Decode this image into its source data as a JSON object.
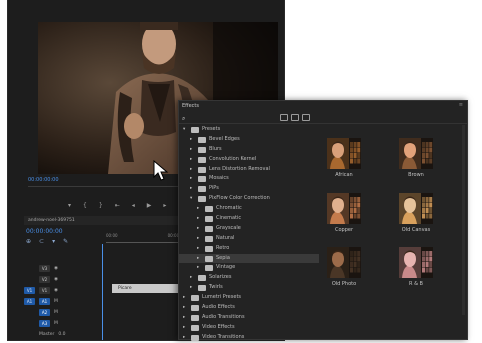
{
  "editor": {
    "program_timecode": "00:00:00:00",
    "sequence_name": "andrew-noel-369751",
    "timeline_timecode": "00:00:00:00",
    "ruler_ticks": [
      "00:00",
      "00:00:05:00"
    ],
    "transport_icons": [
      "marker-icon",
      "in-point-icon",
      "out-point-icon",
      "go-to-in-icon",
      "step-back-icon",
      "play-icon",
      "step-forward-icon",
      "go-to-out-icon"
    ],
    "tracks": [
      {
        "target": "",
        "name": "V3"
      },
      {
        "target": "",
        "name": "V2"
      },
      {
        "target": "V1",
        "name": "V1"
      },
      {
        "target": "A1",
        "name": "A1"
      },
      {
        "target": "",
        "name": "A2"
      },
      {
        "target": "",
        "name": "A3"
      }
    ],
    "master_label": "Master",
    "master_value": "0.0",
    "clip_label": "Picare"
  },
  "effects": {
    "title": "Effects",
    "close_glyph": "≡",
    "tree": [
      {
        "label": "Presets",
        "level": 0,
        "expanded": true
      },
      {
        "label": "Bevel Edges",
        "level": 1
      },
      {
        "label": "Blurs",
        "level": 1
      },
      {
        "label": "Convolution Kernel",
        "level": 1
      },
      {
        "label": "Lens Distortion Removal",
        "level": 1
      },
      {
        "label": "Mosaics",
        "level": 1
      },
      {
        "label": "PiPs",
        "level": 1
      },
      {
        "label": "PixFlow Color Correction",
        "level": 1,
        "expanded": true
      },
      {
        "label": "Chromatic",
        "level": 2
      },
      {
        "label": "Cinematic",
        "level": 2
      },
      {
        "label": "Grayscale",
        "level": 2
      },
      {
        "label": "Natural",
        "level": 2
      },
      {
        "label": "Retro",
        "level": 2
      },
      {
        "label": "Sepia",
        "level": 2,
        "selected": true
      },
      {
        "label": "Vintage",
        "level": 2
      },
      {
        "label": "Solarizes",
        "level": 1
      },
      {
        "label": "Twirls",
        "level": 1
      },
      {
        "label": "Lumetri Presets",
        "level": 0
      },
      {
        "label": "Audio Effects",
        "level": 0
      },
      {
        "label": "Audio Transitions",
        "level": 0
      },
      {
        "label": "Video Effects",
        "level": 0
      },
      {
        "label": "Video Transitions",
        "level": 0
      }
    ],
    "presets": [
      {
        "label": "African",
        "skin": "#d9a07a",
        "tint": "#a8682f"
      },
      {
        "label": "Brown",
        "skin": "#e2a27a",
        "tint": "#8a5a36"
      },
      {
        "label": "Copper",
        "skin": "#e0b08e",
        "tint": "#c47b4c"
      },
      {
        "label": "Old Canvas",
        "skin": "#e6c39a",
        "tint": "#d9a15d"
      },
      {
        "label": "Old Photo",
        "skin": "#9c6b4a",
        "tint": "#4a3626"
      },
      {
        "label": "R & B",
        "skin": "#e7b4b0",
        "tint": "#c98a8a"
      }
    ]
  }
}
